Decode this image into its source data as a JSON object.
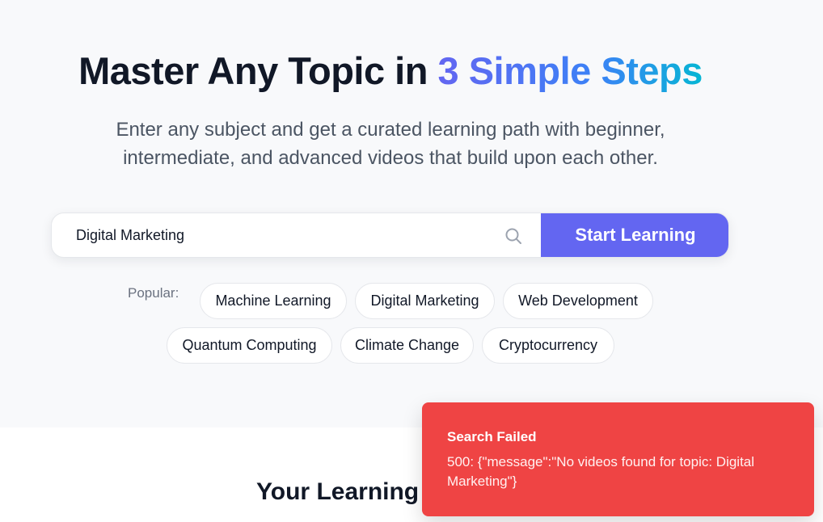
{
  "hero": {
    "headline_prefix": "Master Any Topic in ",
    "headline_highlight": "3 Simple Steps",
    "subtitle_line1": "Enter any subject and get a curated learning path with beginner,",
    "subtitle_line2": "intermediate, and advanced videos that build upon each other."
  },
  "search": {
    "value": "Digital Marketing",
    "icon": "search-icon",
    "button_label": "Start Learning"
  },
  "popular": {
    "label": "Popular:",
    "chips": [
      "Machine Learning",
      "Digital Marketing",
      "Web Development",
      "Quantum Computing",
      "Climate Change",
      "Cryptocurrency"
    ]
  },
  "section": {
    "title": "Your Learning"
  },
  "toast": {
    "title": "Search Failed",
    "message": "500: {\"message\":\"No videos found for topic: Digital Marketing\"}"
  },
  "colors": {
    "accent": "#6366f1",
    "gradient_end": "#06b6d4",
    "error": "#ef4444",
    "hero_background": "#f8f9fb"
  }
}
